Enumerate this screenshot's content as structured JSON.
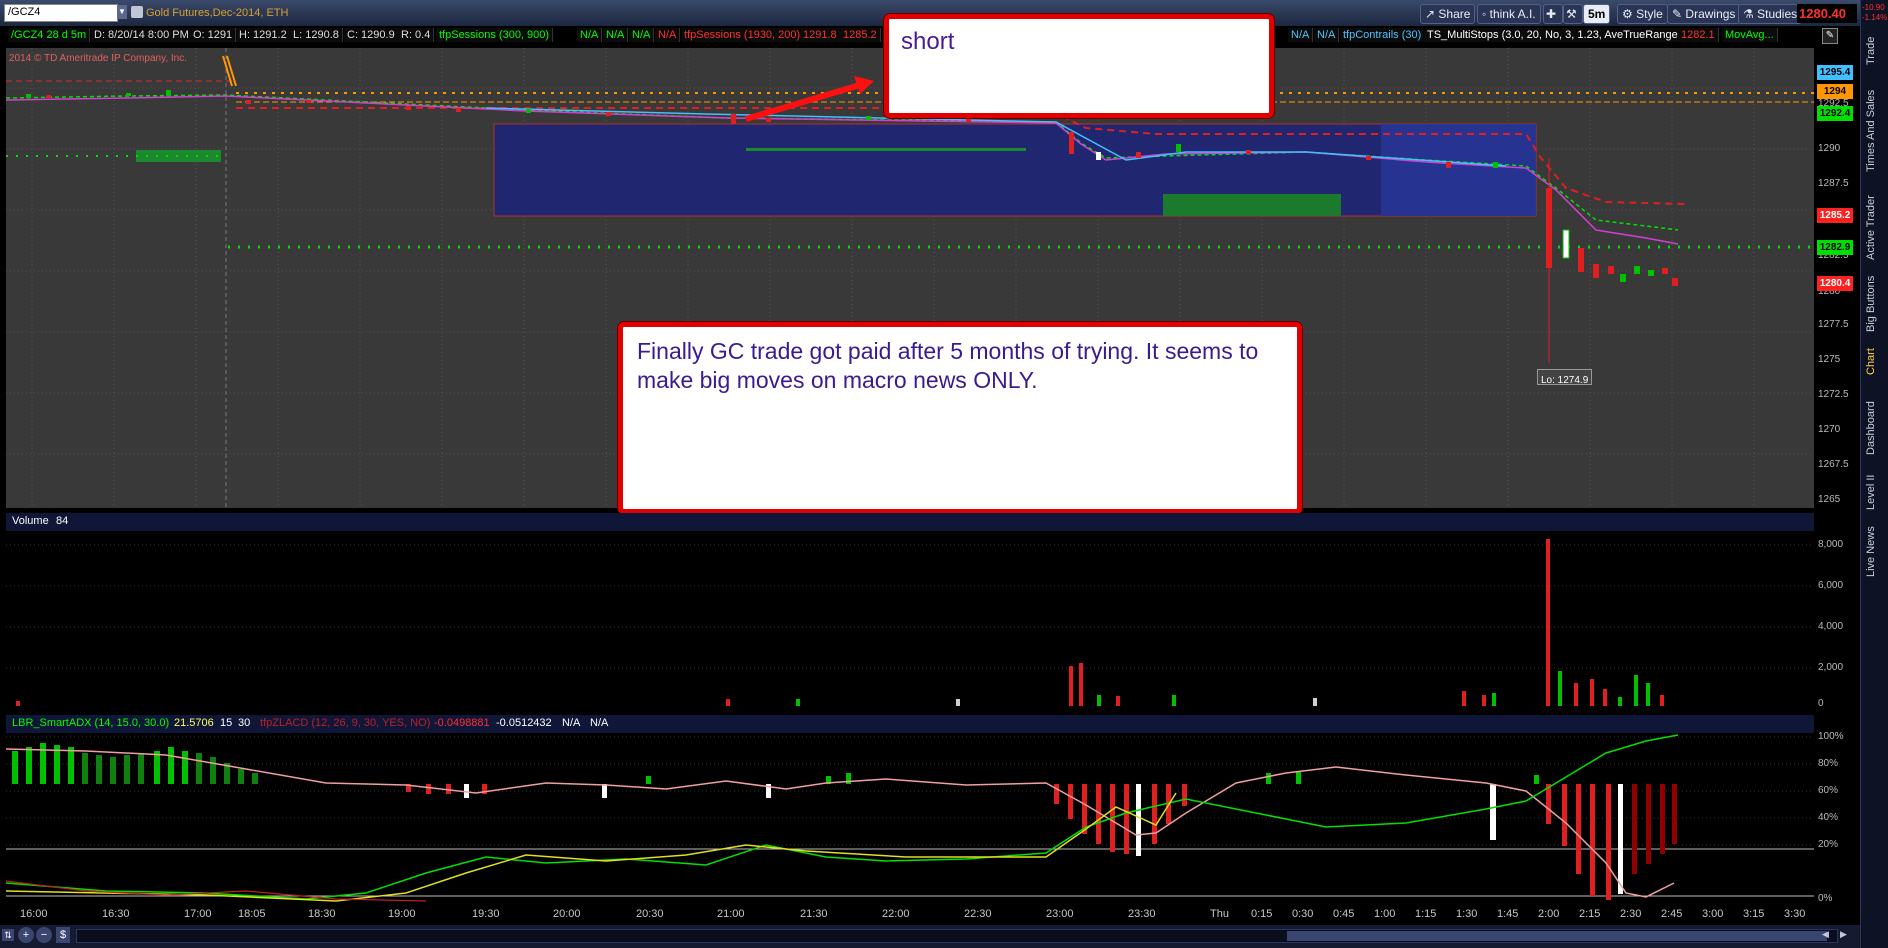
{
  "toolbar": {
    "symbol": "/GCZ4",
    "description": "Gold Futures,Dec-2014, ETH",
    "share": "Share",
    "think": "think A.I.",
    "timeframe": "5m",
    "style": "Style",
    "drawings": "Drawings",
    "studies": "Studies",
    "last_price": "1280.40",
    "change_top": "-10.90",
    "change_bottom": "-1.14%"
  },
  "studybar": {
    "chart_label": "/GCZ4 28 d 5m",
    "date": "D: 8/20/14 8:00 PM",
    "open": "O: 1291",
    "high": "H: 1291.2",
    "low": "L: 1290.8",
    "close": "C: 1290.9",
    "range": "R: 0.4",
    "s1": "tfpSessions (300, 900)",
    "na": "N/A",
    "s2": "tfpSessions (1930, 200)",
    "s2v1": "1291.8",
    "s2v2": "1285.2",
    "s3": "tfpContrails (30)",
    "s4": "TS_MultiStops (3.0, 20, No, 3, 1.23, AveTrueRange)",
    "s4v": "1282.1",
    "s5": "MovAvg...",
    "copyright": "2014 © TD Ameritrade IP Company, Inc."
  },
  "price_scale": [
    "1295",
    "1292.5",
    "1290",
    "1287.5",
    "1285",
    "1282.5",
    "1280",
    "1277.5",
    "1275",
    "1272.5",
    "1270",
    "1267.5",
    "1265"
  ],
  "price_tags": {
    "t1": "1295.4",
    "t2": "1294",
    "t3": "1292.4",
    "t4": "1285.2",
    "t5": "1282.9",
    "t6": "1280.4"
  },
  "low_label": "Lo: 1274.9",
  "annotations": {
    "short": "short",
    "note": "Finally GC trade got paid after 5 months of trying. It seems to make big moves on macro news ONLY."
  },
  "volume": {
    "title": "Volume",
    "value": "84",
    "scale": [
      "8,000",
      "6,000",
      "4,000",
      "2,000",
      "0"
    ]
  },
  "adx": {
    "title": "LBR_SmartADX (14, 15.0, 30.0)",
    "v1": "21.5706",
    "v2": "15",
    "v3": "30",
    "s2": "tfpZLACD (12, 26, 9, 30, YES, NO)",
    "s2v1": "-0.0498881",
    "s2v2": "-0.0512432",
    "na": "N/A",
    "scale": [
      "100%",
      "80%",
      "60%",
      "40%",
      "20%",
      "0%"
    ]
  },
  "time_axis": [
    "16:00",
    "16:30",
    "17:00",
    "18:05",
    "18:30",
    "19:00",
    "19:30",
    "20:00",
    "20:30",
    "21:00",
    "21:30",
    "22:00",
    "22:30",
    "23:00",
    "23:30",
    "Thu",
    "0:15",
    "0:30",
    "0:45",
    "1:00",
    "1:15",
    "1:30",
    "1:45",
    "2:00",
    "2:15",
    "2:30",
    "2:45",
    "3:00",
    "3:15",
    "3:30"
  ],
  "right_rail": [
    "Trade",
    "Times And Sales",
    "Active Trader",
    "Big Buttons",
    "Chart",
    "Dashboard",
    "Level II",
    "Live News"
  ],
  "colors": {
    "up": "#00c000",
    "down": "#e02020",
    "accent_red": "#ff0000",
    "session_box": "#1a237e",
    "price_bg": "#393939"
  }
}
